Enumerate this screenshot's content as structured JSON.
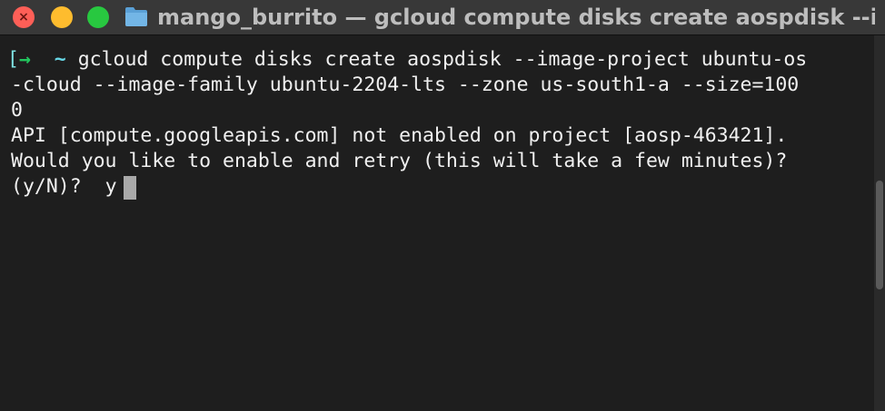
{
  "window": {
    "title": "mango_burrito — gcloud compute disks create aospdisk --i...",
    "folder_icon": "folder-icon"
  },
  "traffic_lights": {
    "close_color": "#fe5f57",
    "minimize_color": "#febc2e",
    "zoom_color": "#28c840",
    "close_glyph": "×"
  },
  "prompt": {
    "bracket": "[",
    "arrow": "→",
    "tilde": "~"
  },
  "terminal": {
    "command_line1": "gcloud compute disks create aospdisk --image-project ubuntu-os",
    "command_line2": "-cloud --image-family ubuntu-2204-lts --zone us-south1-a --size=100",
    "command_line3": "0",
    "output_line1": "API [compute.googleapis.com] not enabled on project [aosp-463421].",
    "output_line2": "Would you like to enable and retry (this will take a few minutes)?",
    "prompt_question": "(y/N)?",
    "user_input": "y"
  }
}
